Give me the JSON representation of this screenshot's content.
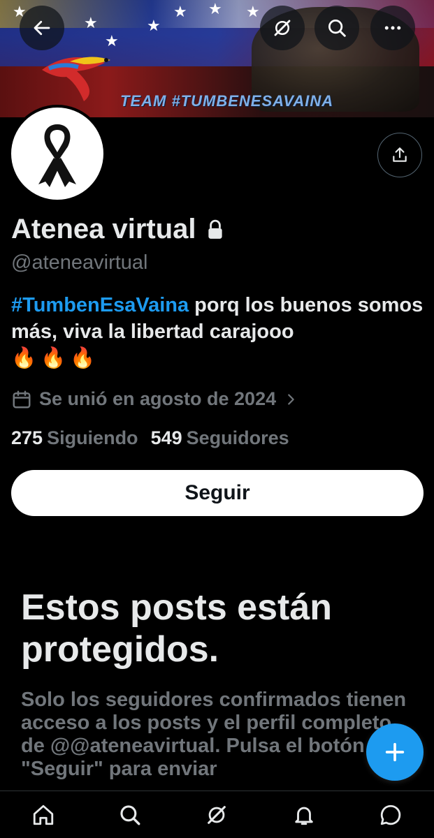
{
  "banner": {
    "text": "TEAM #TUMBENESAVAINA"
  },
  "topbar": {
    "back_icon": "arrow-left-icon",
    "grok_icon": "grok-icon",
    "search_icon": "search-icon",
    "more_icon": "more-horizontal-icon"
  },
  "profile": {
    "display_name": "Atenea virtual",
    "handle": "@ateneavirtual",
    "bio_hashtag": "#TumbenEsaVaina",
    "bio_text": " porq los buenos somos más, viva la libertad carajooo",
    "bio_emojis": "🔥🔥🔥",
    "joined": "Se unió en agosto de 2024",
    "following_count": "275",
    "following_label": "Siguiendo",
    "followers_count": "549",
    "followers_label": "Seguidores",
    "follow_button": "Seguir"
  },
  "protected": {
    "title": "Estos posts están protegidos.",
    "description": "Solo los seguidores confirmados tienen acceso a los posts y el perfil completo de @@ateneavirtual. Pulsa el botón \"Seguir\" para enviar"
  },
  "colors": {
    "accent": "#1d9bf0",
    "background": "#000000",
    "muted": "#71767b",
    "text": "#e7e9ea"
  },
  "bottom_nav": [
    "home-icon",
    "search-icon",
    "grok-icon",
    "notifications-icon",
    "messages-icon"
  ]
}
